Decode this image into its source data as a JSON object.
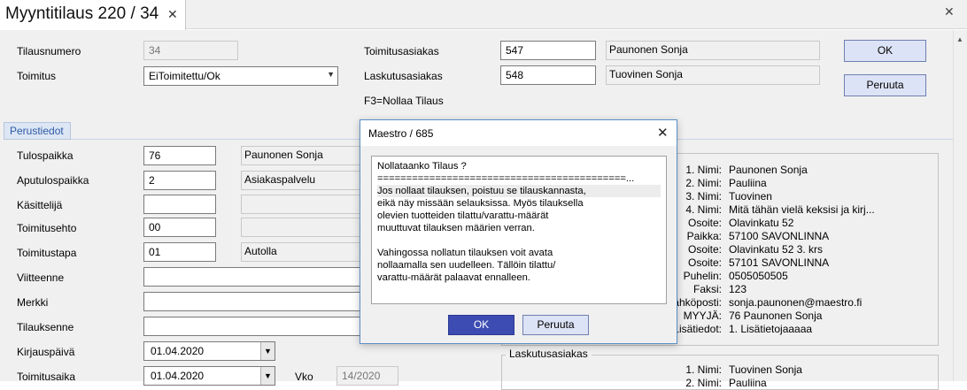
{
  "tab": {
    "title": "Myyntitilaus 220 / 34",
    "close": "✕"
  },
  "window": {
    "close": "✕"
  },
  "header": {
    "tilausnumero_label": "Tilausnumero",
    "tilausnumero_value": "34",
    "toimitus_label": "Toimitus",
    "toimitus_value": "EiToimitettu/Ok",
    "toimitusasiakas_label": "Toimitusasiakas",
    "toimitusasiakas_value": "547",
    "toimitusasiakas_name": "Paunonen Sonja",
    "laskutusasiakas_label": "Laskutusasiakas",
    "laskutusasiakas_value": "548",
    "laskutusasiakas_name": "Tuovinen Sonja",
    "hint": "F3=Nollaa Tilaus",
    "ok_label": "OK",
    "cancel_label": "Peruuta"
  },
  "section_tab": "Perustiedot",
  "form": {
    "tulospaikka_label": "Tulospaikka",
    "tulospaikka_value": "76",
    "tulospaikka_name": "Paunonen Sonja",
    "aputulospaikka_label": "Aputulospaikka",
    "aputulospaikka_value": "2",
    "aputulospaikka_name": "Asiakaspalvelu",
    "kasittelija_label": "Käsittelijä",
    "toimitusehto_label": "Toimitusehto",
    "toimitusehto_value": "00",
    "toimitustapa_label": "Toimitustapa",
    "toimitustapa_value": "01",
    "toimitustapa_name": "Autolla",
    "viitteenne_label": "Viitteenne",
    "merkki_label": "Merkki",
    "tilauksenne_label": "Tilauksenne",
    "kirjauspaiva_label": "Kirjauspäivä",
    "kirjauspaiva_value": "01.04.2020",
    "toimitusaika_label": "Toimitusaika",
    "toimitusaika_value": "01.04.2020",
    "vko_label": "Vko",
    "vko_value": "14/2020"
  },
  "customer_info": {
    "rows": [
      {
        "label": "1. Nimi:",
        "value": "Paunonen Sonja"
      },
      {
        "label": "2. Nimi:",
        "value": "Pauliina"
      },
      {
        "label": "3. Nimi:",
        "value": "Tuovinen"
      },
      {
        "label": "4. Nimi:",
        "value": "Mitä tähän vielä keksisi ja kirj..."
      },
      {
        "label": "Osoite:",
        "value": "Olavinkatu 52"
      },
      {
        "label": "Paikka:",
        "value": "57100 SAVONLINNA"
      },
      {
        "label": "Osoite:",
        "value": "Olavinkatu 52 3. krs"
      },
      {
        "label": "Osoite:",
        "value": "57101 SAVONLINNA"
      },
      {
        "label": "Puhelin:",
        "value": "0505050505"
      },
      {
        "label": "Faksi:",
        "value": "123"
      },
      {
        "label": "Sähköposti:",
        "value": "sonja.paunonen@maestro.fi"
      },
      {
        "label": "MYYJÄ:",
        "value": "76  Paunonen Sonja"
      },
      {
        "label": "Lisätiedot:",
        "value": "1. Lisätietojaaaaa"
      }
    ]
  },
  "billing_info": {
    "title": "Laskutusasiakas",
    "rows": [
      {
        "label": "1. Nimi:",
        "value": "Tuovinen Sonja"
      },
      {
        "label": "2. Nimi:",
        "value": "Pauliina"
      }
    ]
  },
  "dialog": {
    "title": "Maestro / 685",
    "close": "✕",
    "lines": [
      "Nollataanko Tilaus ?",
      "===========================================...",
      "Jos nollaat tilauksen, poistuu se tilauskannasta,",
      "eikä näy missään selauksissa. Myös tilauksella",
      "olevien tuotteiden tilattu/varattu-määrät",
      "muuttuvat tilauksen määrien verran.",
      "",
      "Vahingossa nollatun tilauksen voit avata",
      "nollaamalla sen uudelleen. Tällöin tilattu/",
      "varattu-määrät palaavat ennalleen."
    ],
    "ok_label": "OK",
    "cancel_label": "Peruuta"
  },
  "icons": {
    "dropdown": "chevron-down-icon",
    "close": "close-icon"
  }
}
